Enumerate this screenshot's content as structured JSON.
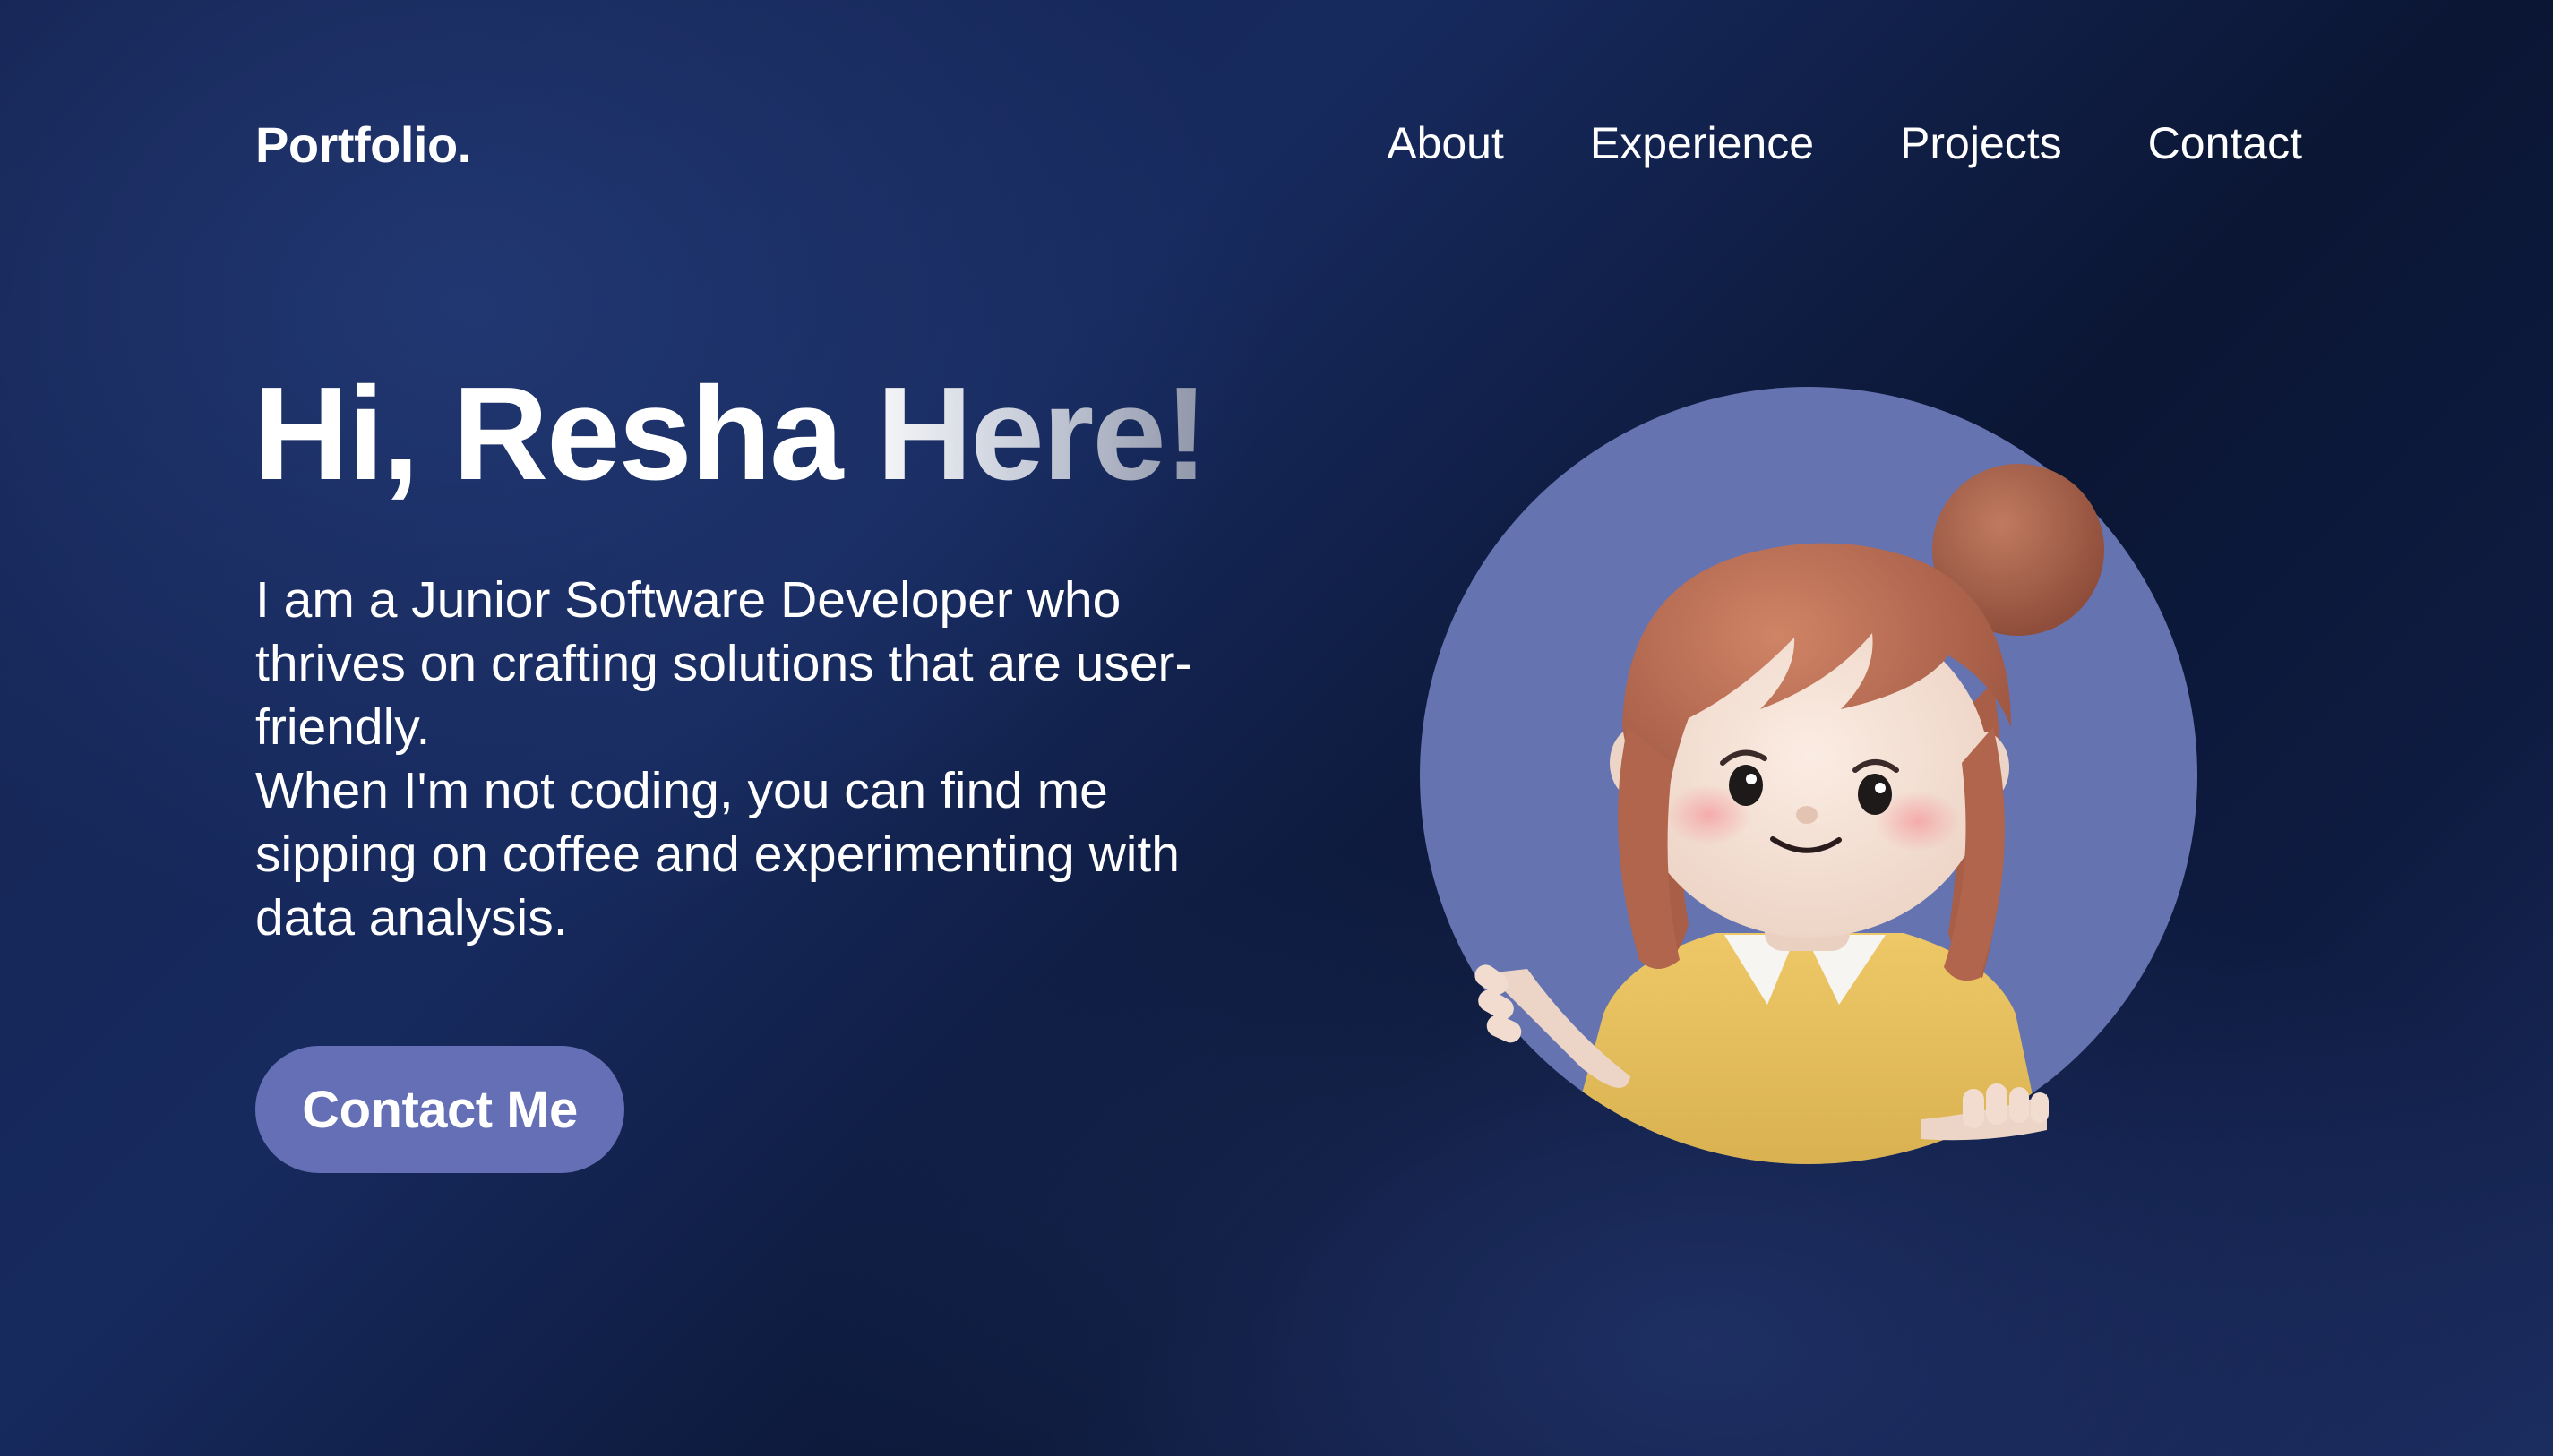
{
  "nav": {
    "brand": "Portfolio.",
    "links": [
      {
        "label": "About"
      },
      {
        "label": "Experience"
      },
      {
        "label": "Projects"
      },
      {
        "label": "Contact"
      }
    ]
  },
  "hero": {
    "title": "Hi, Resha Here!",
    "description": [
      "I am a Junior Software Developer who thrives on crafting solutions that are user-friendly.",
      "When I'm not coding, you can find me sipping on coffee and experimenting with data analysis."
    ],
    "cta_label": "Contact Me"
  },
  "colors": {
    "background": "#14224f",
    "accent": "#646fb6",
    "text": "#ffffff"
  }
}
